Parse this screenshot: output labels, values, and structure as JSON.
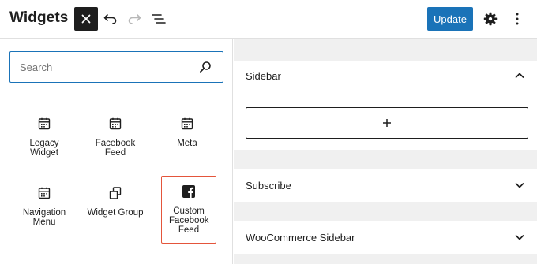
{
  "header": {
    "title": "Widgets",
    "update_label": "Update"
  },
  "search": {
    "placeholder": "Search"
  },
  "blocks": [
    {
      "label": "Legacy Widget",
      "icon": "calendar-icon"
    },
    {
      "label": "Facebook Feed",
      "icon": "calendar-icon"
    },
    {
      "label": "Meta",
      "icon": "calendar-icon"
    },
    {
      "label": "Navigation Menu",
      "icon": "calendar-icon"
    },
    {
      "label": "Widget Group",
      "icon": "group-icon"
    },
    {
      "label": "Custom Facebook Feed",
      "icon": "facebook-icon",
      "highlighted": true
    }
  ],
  "areas": [
    {
      "label": "Sidebar",
      "expanded": true
    },
    {
      "label": "Subscribe",
      "expanded": false
    },
    {
      "label": "WooCommerce Sidebar",
      "expanded": false
    }
  ],
  "colors": {
    "accent": "#1a73b8",
    "highlight": "#e4553b",
    "dark": "#1e1e1e"
  }
}
